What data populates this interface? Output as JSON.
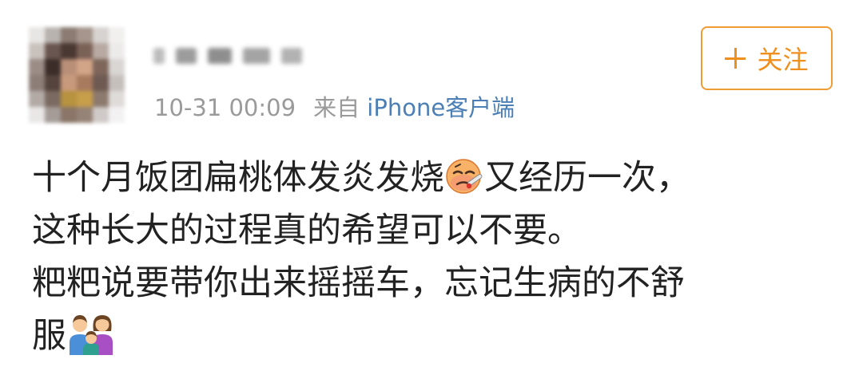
{
  "post": {
    "meta": {
      "time": "10-31 00:09",
      "source_prefix": "来自",
      "source": "iPhone客户端"
    },
    "follow_button": {
      "label": "关注",
      "icon": "plus-icon"
    },
    "content": {
      "line1_a": "十个月饭团扁桃体发炎发烧",
      "line1_emoji": "sick-face-with-thermometer-emoji",
      "line1_b": "又经历一次，",
      "line2": "这种长大的过程真的希望可以不要。",
      "line3": "粑粑说要带你出来摇摇车，忘记生病的不舒",
      "line4": "服",
      "line4_emoji": "family-emoji"
    }
  },
  "colors": {
    "accent_orange": "#ef8f1e",
    "meta_gray": "#9a9a9a",
    "link_blue": "#4c7fb5",
    "text": "#222222"
  }
}
